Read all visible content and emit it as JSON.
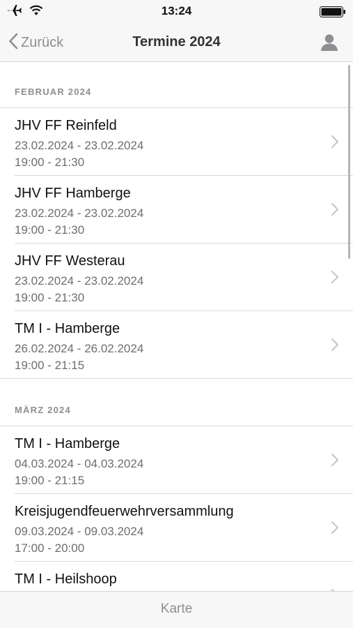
{
  "status_bar": {
    "time": "13:24",
    "icons": [
      "airplane-icon",
      "wifi-icon",
      "battery-icon"
    ]
  },
  "nav": {
    "back_label": "Zurück",
    "title": "Termine 2024",
    "profile_icon": "person-icon"
  },
  "sections": [
    {
      "header": "FEBRUAR 2024",
      "events": [
        {
          "title": "JHV FF Reinfeld",
          "date": "23.02.2024 - 23.02.2024",
          "time": "19:00 - 21:30"
        },
        {
          "title": "JHV FF Hamberge",
          "date": "23.02.2024 - 23.02.2024",
          "time": "19:00 - 21:30"
        },
        {
          "title": "JHV FF Westerau",
          "date": "23.02.2024 - 23.02.2024",
          "time": "19:00 - 21:30"
        },
        {
          "title": "TM I - Hamberge",
          "date": "26.02.2024 - 26.02.2024",
          "time": "19:00 - 21:15"
        }
      ]
    },
    {
      "header": "MÄRZ 2024",
      "events": [
        {
          "title": "TM I - Hamberge",
          "date": "04.03.2024 - 04.03.2024",
          "time": "19:00 - 21:15"
        },
        {
          "title": "Kreisjugendfeuerwehrversammlung",
          "date": "09.03.2024 - 09.03.2024",
          "time": "17:00 - 20:00"
        },
        {
          "title": "TM I - Heilshoop",
          "date": "",
          "time": ""
        }
      ]
    }
  ],
  "toolbar": {
    "map_label": "Karte"
  },
  "colors": {
    "bar_background": "#f7f7f7",
    "separator": "#dadada",
    "secondary_text": "#6d6d72",
    "chevron": "#c7c7cc"
  }
}
